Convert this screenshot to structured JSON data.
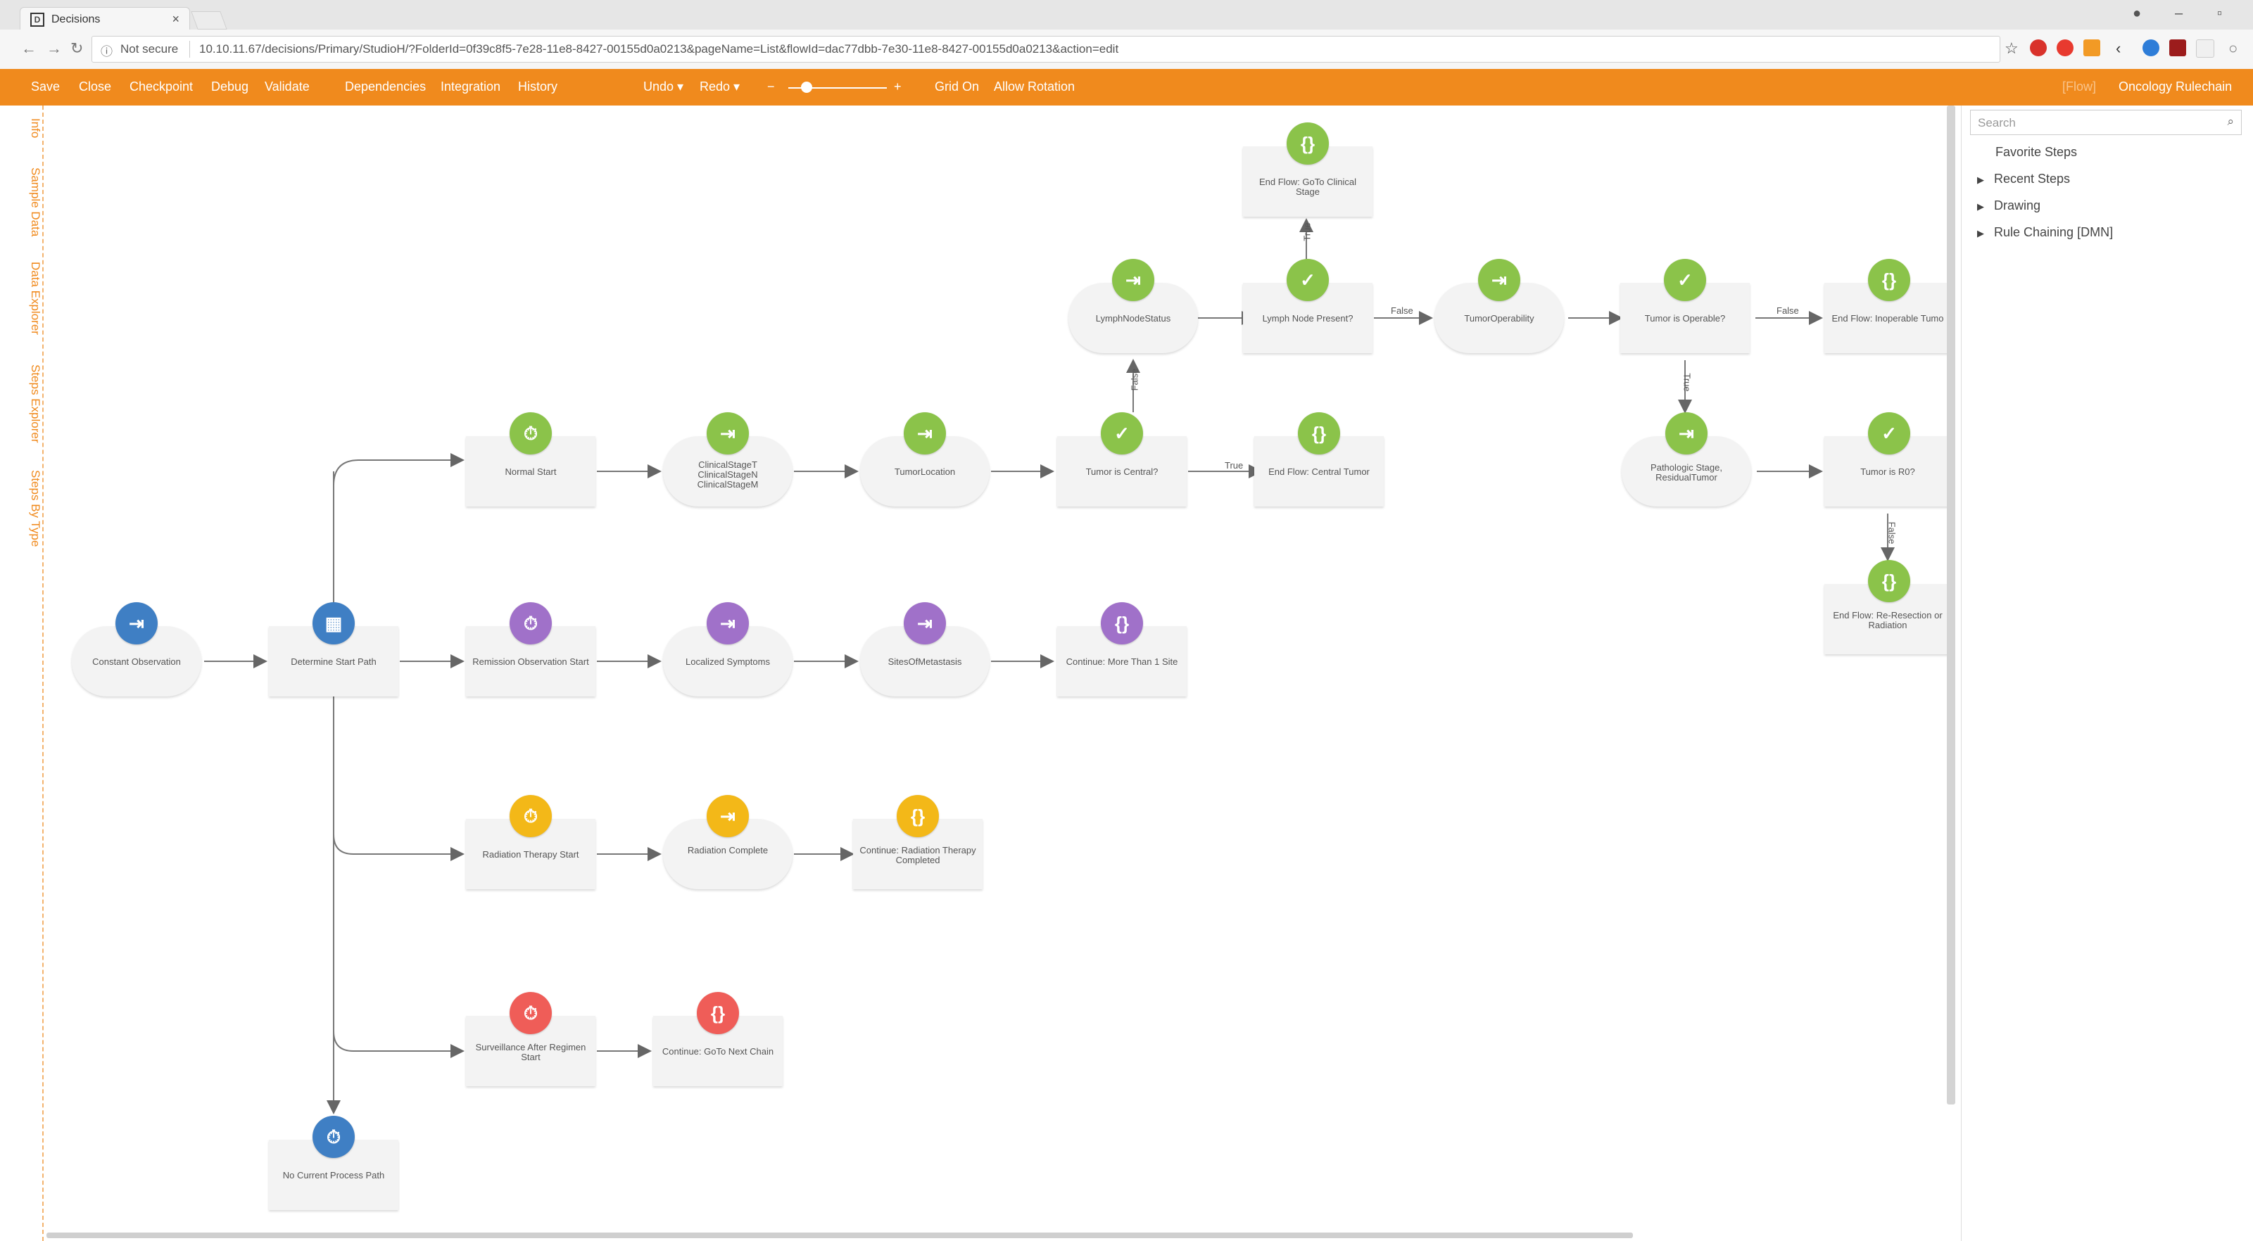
{
  "browser": {
    "tab_title": "Decisions",
    "tab_close": "×",
    "not_secure": "Not secure",
    "url": "10.10.11.67/decisions/Primary/StudioH/?FolderId=0f39c8f5-7e28-11e8-8427-00155d0a0213&pageName=List&flowId=dac77dbb-7e30-11e8-8427-00155d0a0213&action=edit"
  },
  "toolbar": {
    "save": "Save",
    "close": "Close",
    "checkpoint": "Checkpoint",
    "debug": "Debug",
    "validate": "Validate",
    "dependencies": "Dependencies",
    "integration": "Integration",
    "history": "History",
    "undo": "Undo ▾",
    "redo": "Redo ▾",
    "zoom_minus": "−",
    "zoom_plus": "+",
    "grid_on": "Grid On",
    "allow_rotation": "Allow Rotation",
    "flow_tag": "[Flow]",
    "project_name": "Oncology Rulechain"
  },
  "left_rail": [
    "Info",
    "Sample Data",
    "Data Explorer",
    "Steps Explorer",
    "Steps By Type"
  ],
  "right_panel": {
    "search_placeholder": "Search",
    "items": [
      "Favorite Steps",
      "Recent Steps",
      "Drawing",
      "Rule Chaining [DMN]"
    ]
  },
  "nodes": {
    "constant_observation": "Constant Observation",
    "determine_start_path": "Determine Start Path",
    "normal_start": "Normal Start",
    "clinical_stage": "ClinicalStageT ClinicalStageN ClinicalStageM",
    "tumor_location": "TumorLocation",
    "tumor_is_central": "Tumor is Central?",
    "end_flow_central_tumor": "End Flow: Central Tumor",
    "lymph_node_status": "LymphNodeStatus",
    "lymph_node_present": "Lymph Node Present?",
    "end_flow_goto_clinical_stage": "End Flow: GoTo Clinical Stage",
    "tumor_operability": "TumorOperability",
    "tumor_is_operable": "Tumor is Operable?",
    "end_flow_inoperable_tumor": "End Flow: Inoperable Tumo",
    "pathologic_stage": "Pathologic Stage, ResidualTumor",
    "tumor_is_r0": "Tumor is R0?",
    "end_flow_re_resection": "End Flow: Re-Resection or Radiation",
    "remission_observation_start": "Remission Observation Start",
    "localized_symptoms": "Localized Symptoms",
    "sites_of_metastasis": "SitesOfMetastasis",
    "continue_more_than_1_site": "Continue: More Than 1 Site",
    "radiation_therapy_start": "Radiation Therapy Start",
    "radiation_complete": "Radiation Complete",
    "continue_radiation_therapy_completed": "Continue: Radiation Therapy Completed",
    "surveillance_after_regimen_start": "Surveillance After Regimen Start",
    "continue_goto_next_chain": "Continue: GoTo Next Chain",
    "no_current_process_path": "No Current Process Path"
  },
  "edge_labels": {
    "true": "True",
    "false": "False"
  },
  "colors": {
    "toolbar": "#f08a1d",
    "green": "#8bc34a",
    "blue": "#3f7fc4",
    "purple": "#a071c9",
    "yellow": "#f3b818",
    "red": "#ef5d58"
  }
}
